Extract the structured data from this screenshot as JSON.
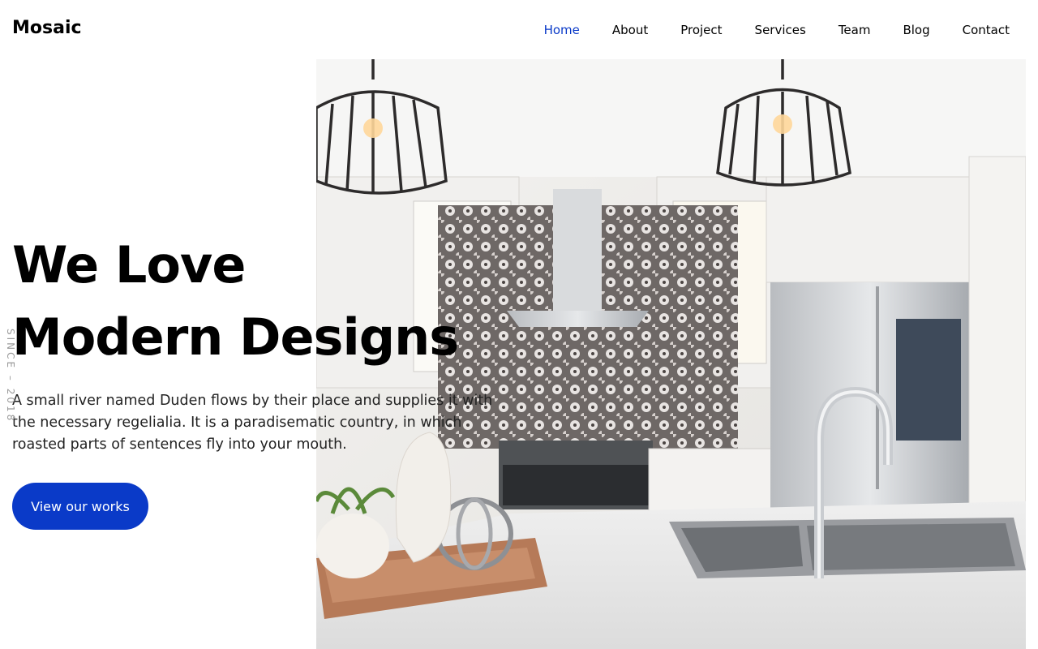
{
  "brand": {
    "name": "Mosaic"
  },
  "nav": {
    "items": [
      {
        "label": "Home",
        "active": true
      },
      {
        "label": "About"
      },
      {
        "label": "Project"
      },
      {
        "label": "Services"
      },
      {
        "label": "Team"
      },
      {
        "label": "Blog"
      },
      {
        "label": "Contact"
      }
    ]
  },
  "hero": {
    "headline_line1": "We Love",
    "headline_line2": "Modern Designs",
    "description": "A small river named Duden flows by their place and supplies it with the necessary regelialia. It is a paradisematic country, in which roasted parts of sentences fly into your mouth.",
    "cta_label": "View our works",
    "since_text": "SINCE – 2018"
  },
  "colors": {
    "accent": "#0a3ac8",
    "active_nav": "#0a3ac8",
    "text": "#000000",
    "muted": "#9a9a9a"
  },
  "icons": {
    "hero_image": "kitchen-photo"
  }
}
